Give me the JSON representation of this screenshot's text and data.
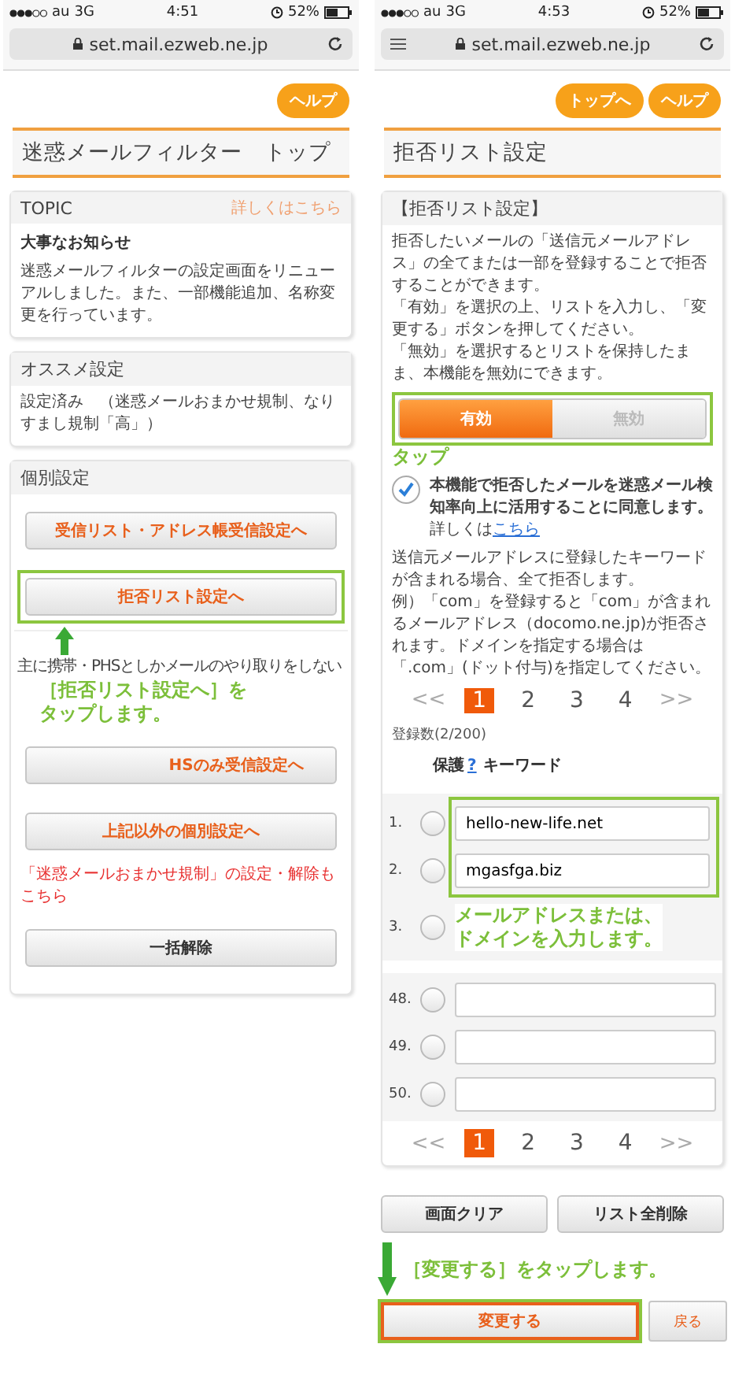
{
  "left_screen": {
    "status_bar": {
      "carrier": "au",
      "network": "3G",
      "time": "4:51",
      "battery": "52%"
    },
    "url": "set.mail.ezweb.ne.jp",
    "header_buttons": [
      "ヘルプ"
    ],
    "page_title": "迷惑メールフィルター　トップ",
    "topic": {
      "title": "TOPIC",
      "link": "詳しくはこちら",
      "heading": "大事なお知らせ",
      "body": "迷惑メールフィルターの設定画面をリニューアルしました。また、一部機能追加、名称変更を行っています。"
    },
    "recommended": {
      "title": "オススメ設定",
      "body": "設定済み　（迷惑メールおまかせ規制、なりすまし規制「高」）"
    },
    "individual": {
      "title": "個別設定",
      "items": [
        {
          "kind": "button",
          "label": "受信リスト・アドレス帳受信設定へ",
          "highlighted": false
        },
        {
          "kind": "button",
          "label": "拒否リスト設定へ",
          "highlighted": true
        },
        {
          "kind": "note",
          "text": "主に携帯・PHSとしかメールのやり取りをしない"
        },
        {
          "kind": "button",
          "label": "HSのみ受信設定へ",
          "highlighted": false
        },
        {
          "kind": "button",
          "label": "上記以外の個別設定へ",
          "highlighted": false
        },
        {
          "kind": "warning",
          "text": "「迷惑メールおまかせ規制」の設定・解除もこちら"
        },
        {
          "kind": "plain_button",
          "label": "一括解除",
          "highlighted": false
        }
      ]
    },
    "callout": [
      "［拒否リスト設定へ］を",
      "タップします。"
    ]
  },
  "right_screen": {
    "status_bar": {
      "carrier": "au",
      "network": "3G",
      "time": "4:53",
      "battery": "52%"
    },
    "url": "set.mail.ezweb.ne.jp",
    "header_buttons": [
      "トップへ",
      "ヘルプ"
    ],
    "page_title": "拒否リスト設定",
    "card_title": "【拒否リスト設定】",
    "intro": [
      "拒否したいメールの「送信元メールアドレス」の全てまたは一部を登録することで拒否することができます。",
      "「有効」を選択の上、リストを入力し、「変更する」ボタンを押してください。",
      "「無効」を選択するとリストを保持したまま、本機能を無効にできます。"
    ],
    "toggle": {
      "highlighted": true,
      "options": [
        {
          "label": "有効",
          "selected": true
        },
        {
          "label": "無効",
          "selected": false
        }
      ]
    },
    "toggle_callout": "タップ",
    "consent": {
      "checked": true,
      "text": "本機能で拒否したメールを迷惑メール検知率向上に活用することに同意します。",
      "link_prefix": "詳しくは",
      "link": "こちら"
    },
    "notes": [
      "送信元メールアドレスに登録したキーワードが含まれる場合、全て拒否します。",
      "例）「com」を登録すると「com」が含まれるメールアドレス（docomo.ne.jp)が拒否されます。ドメインを指定する場合は「.com」(ドット付与)を指定してください。"
    ],
    "pager_top": {
      "prev": "<<",
      "next": ">>",
      "pages": [
        {
          "label": "1",
          "selected": true
        },
        {
          "label": "2",
          "selected": false
        },
        {
          "label": "3",
          "selected": false
        },
        {
          "label": "4",
          "selected": false
        }
      ]
    },
    "count": "登録数(2/200)",
    "list_header": {
      "protect": "保護",
      "help": "?",
      "keyword": "キーワード"
    },
    "rows_top": {
      "highlighted": true,
      "rows": [
        {
          "number": "1.",
          "checked": false,
          "value": "hello-new-life.net"
        },
        {
          "number": "2.",
          "checked": false,
          "value": "mgasfga.biz"
        }
      ]
    },
    "row_callout": {
      "number": "3.",
      "checked": false,
      "lines": [
        "メールアドレスまたは、",
        "ドメインを入力します。"
      ]
    },
    "rows_bottom": [
      {
        "number": "48.",
        "checked": false
      },
      {
        "number": "49.",
        "checked": false
      },
      {
        "number": "50.",
        "checked": false
      }
    ],
    "pager_bottom": {
      "prev": "<<",
      "next": ">>",
      "pages": [
        {
          "label": "1",
          "selected": true
        },
        {
          "label": "2",
          "selected": false
        },
        {
          "label": "3",
          "selected": false
        },
        {
          "label": "4",
          "selected": false
        }
      ]
    },
    "action_buttons": [
      "画面クリア",
      "リスト全削除"
    ],
    "submit_callout": "［変更する］をタップします。",
    "submit": {
      "label": "変更する",
      "highlighted": true
    },
    "back": "戻る"
  }
}
